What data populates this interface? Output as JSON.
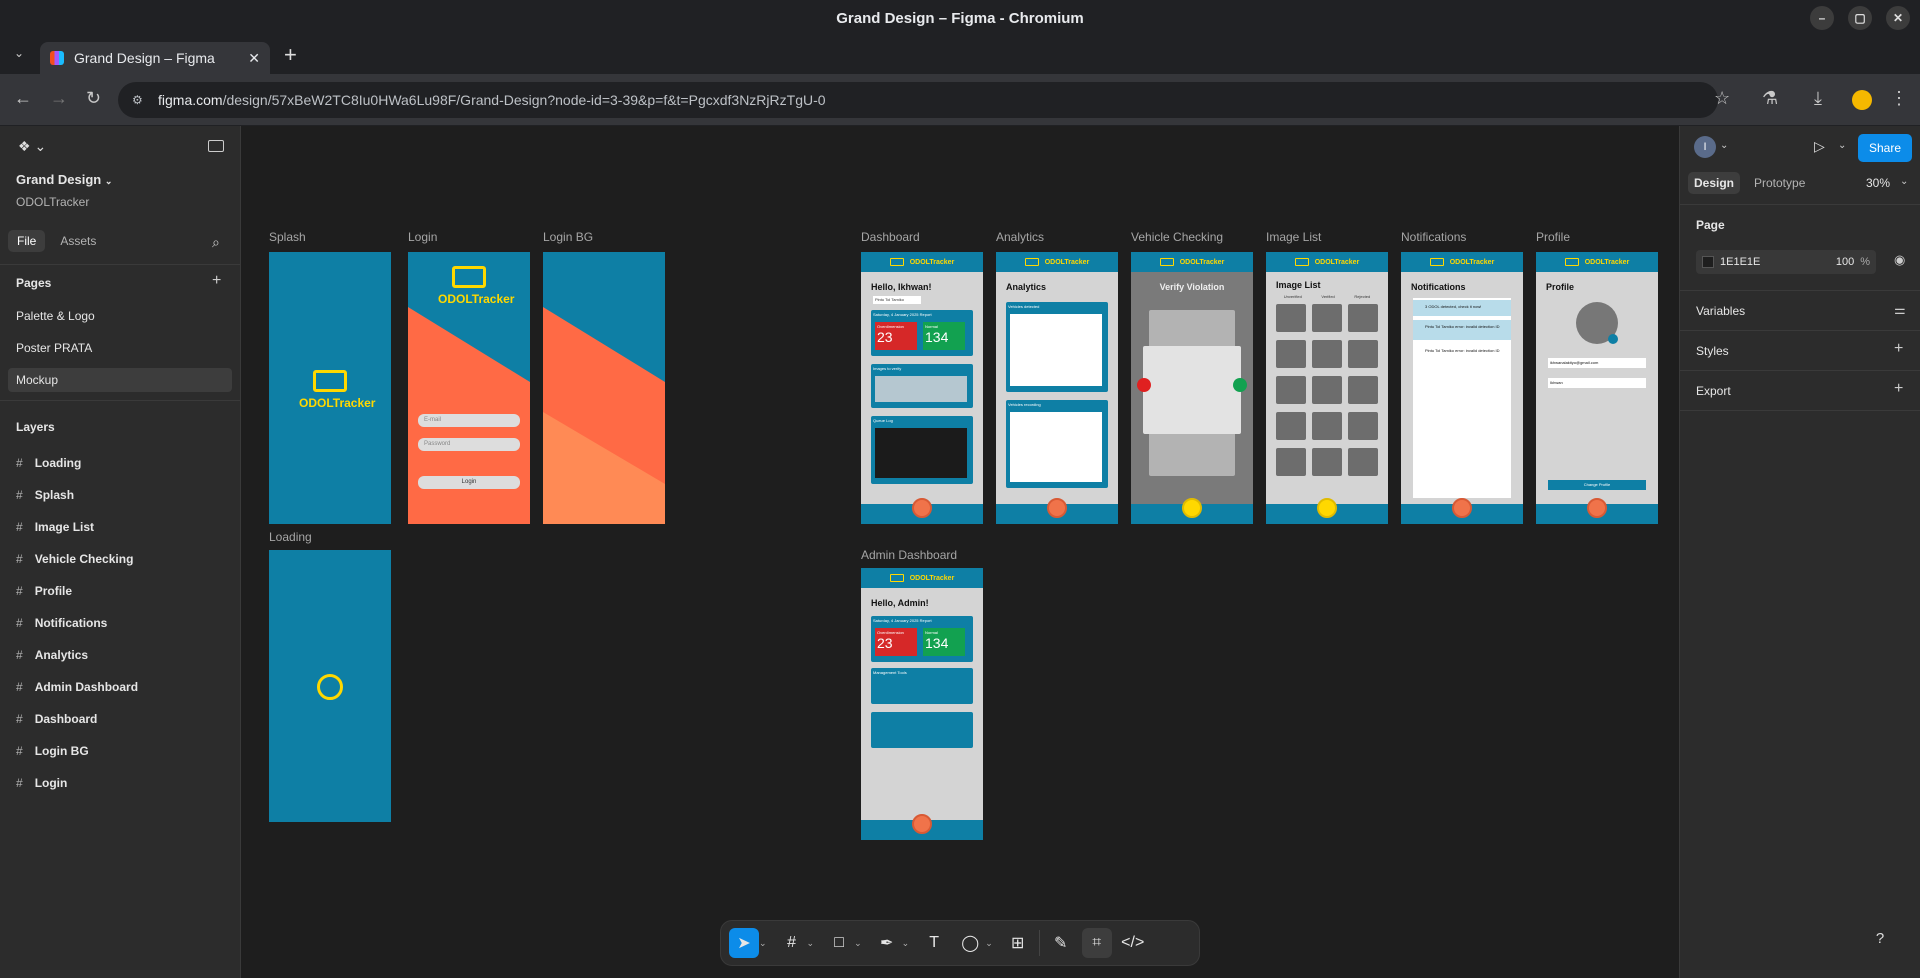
{
  "window": {
    "title": "Grand Design – Figma - Chromium"
  },
  "tab": {
    "title": "Grand Design – Figma",
    "new_tab": "+"
  },
  "address": {
    "domain": "figma.com",
    "path": "/design/57xBeW2TC8Iu0HWa6Lu98F/Grand-Design?node-id=3-39&p=f&t=Pgcxdf3NzRjRzTgU-0"
  },
  "left": {
    "file_name": "Grand Design",
    "team": "ODOLTracker",
    "tab_file": "File",
    "tab_assets": "Assets",
    "pages_title": "Pages",
    "pages": [
      "Palette & Logo",
      "Poster PRATA",
      "Mockup"
    ],
    "layers_title": "Layers",
    "layers": [
      "Loading",
      "Splash",
      "Image List",
      "Vehicle Checking",
      "Profile",
      "Notifications",
      "Analytics",
      "Admin Dashboard",
      "Dashboard",
      "Login BG",
      "Login"
    ]
  },
  "canvas": {
    "frames": {
      "splash": "Splash",
      "login": "Login",
      "login_bg": "Login BG",
      "loading": "Loading",
      "dashboard": "Dashboard",
      "analytics": "Analytics",
      "vehicle": "Vehicle Checking",
      "imagelist": "Image List",
      "notifications": "Notifications",
      "profile": "Profile",
      "admin": "Admin Dashboard"
    },
    "brand": "ODOLTracker",
    "login": {
      "email": "E-mail",
      "password": "Password",
      "button": "Login"
    },
    "dashboard": {
      "greeting": "Hello, Ikhwan!",
      "select": "Pintu Tol Tamiko",
      "report": "Saturday, 4 January 2025 Report",
      "over_label": "Overdimension",
      "over_value": "23",
      "normal_label": "Normal",
      "normal_value": "134",
      "images_title": "Images to verify",
      "queue_title": "Queue Log"
    },
    "analytics": {
      "title": "Analytics",
      "card1": "Vehicles detected",
      "card2": "Vehicles recording"
    },
    "vehicle": {
      "title": "Verify Violation"
    },
    "imagelist": {
      "title": "Image List",
      "tabs": [
        "Unverified",
        "Verified",
        "Rejected"
      ]
    },
    "notifications": {
      "title": "Notifications",
      "items": [
        "3 ODOL detected, check it now!",
        "Pintu Tol Tamiko error: invalid detection ID",
        "Pintu Tol Tamiko error: invalid detection ID"
      ]
    },
    "profile": {
      "title": "Profile",
      "email": "ikhwanalaktiyo@gmail.com",
      "name": "Ikhwan",
      "button": "Change Profile"
    },
    "admin": {
      "greeting": "Hello, Admin!",
      "report": "Saturday, 4 January 2025 Report",
      "over_label": "Overdimension",
      "over_value": "23",
      "normal_label": "Normal",
      "normal_value": "134",
      "tools": "Management Tools"
    }
  },
  "right": {
    "avatar": "I",
    "tab_design": "Design",
    "tab_prototype": "Prototype",
    "zoom": "30%",
    "share": "Share",
    "page_title": "Page",
    "page_color": "1E1E1E",
    "page_opacity": "100",
    "percent": "%",
    "variables": "Variables",
    "styles": "Styles",
    "export": "Export"
  },
  "help": "?"
}
